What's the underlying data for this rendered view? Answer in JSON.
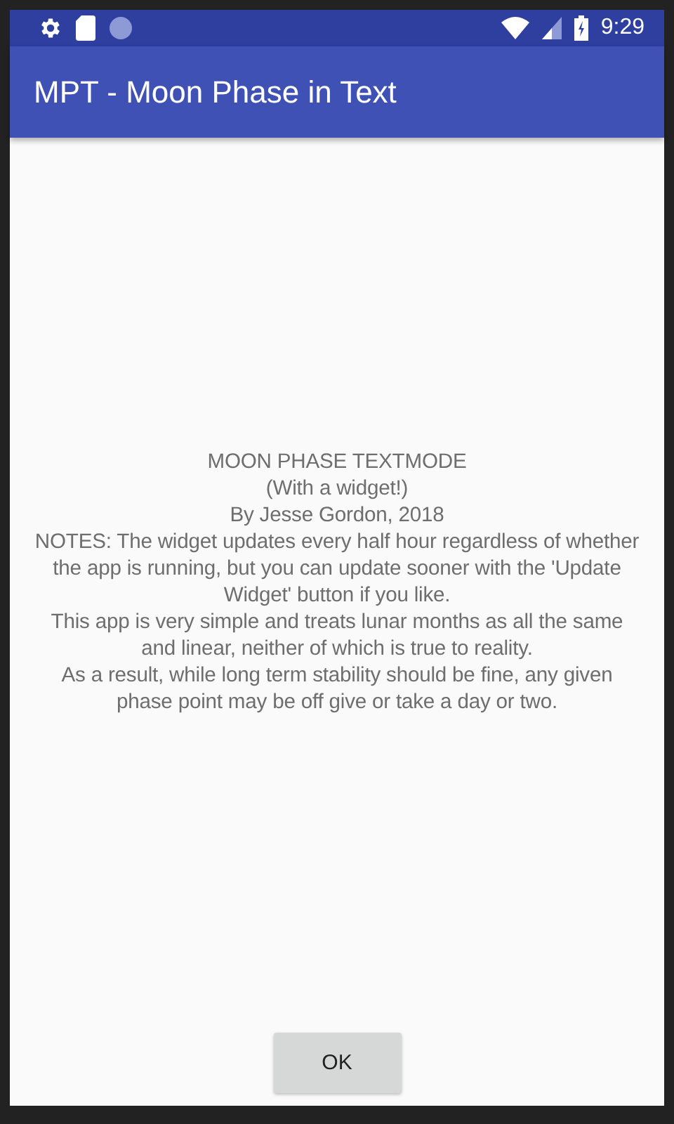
{
  "status_bar": {
    "time": "9:29"
  },
  "app_bar": {
    "title": "MPT - Moon Phase in Text"
  },
  "body_lines": [
    "MOON PHASE TEXTMODE",
    "(With a widget!)",
    "By Jesse Gordon, 2018",
    "NOTES: The widget updates every half hour regardless of whether",
    "the app is running, but you can update sooner with the 'Update",
    "Widget' button if you like.",
    "This app is very simple and treats lunar months as all the same",
    "and linear, neither of which is true to reality.",
    "As a result, while long term stability should be fine, any given",
    "phase point may be off give or take a day or two."
  ],
  "buttons": [
    "OK"
  ]
}
